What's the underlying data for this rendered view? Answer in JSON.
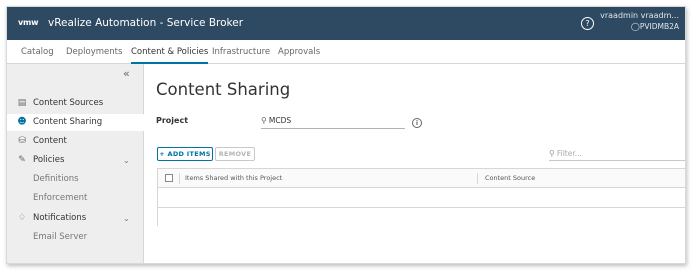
{
  "header": {
    "logo": "vmw",
    "title": "vRealize Automation - Service Broker",
    "help_icon": "help-circle-icon",
    "user_name": "vraadmin vraadm...",
    "org": "PVIDMB2A",
    "colors": {
      "header_bg": "#2e4a62",
      "accent": "#0072a3"
    }
  },
  "topnav": {
    "tabs": [
      {
        "label": "Catalog"
      },
      {
        "label": "Deployments"
      },
      {
        "label": "Content & Policies",
        "active": true
      },
      {
        "label": "Infrastructure"
      },
      {
        "label": "Approvals"
      }
    ]
  },
  "sidebar": {
    "collapse_icon": "double-chevron-left-icon",
    "items": [
      {
        "label": "Content Sources",
        "icon": "content-sources-icon"
      },
      {
        "label": "Content Sharing",
        "icon": "person-icon",
        "active": true
      },
      {
        "label": "Content",
        "icon": "content-icon"
      },
      {
        "label": "Policies",
        "icon": "policies-icon",
        "expandable": true
      },
      {
        "label": "Definitions"
      },
      {
        "label": "Enforcement"
      },
      {
        "label": "Notifications",
        "icon": "bell-icon",
        "expandable": true
      },
      {
        "label": "Email Server"
      }
    ]
  },
  "main": {
    "title": "Content Sharing",
    "project_label": "Project",
    "project_value": "MCDS",
    "info_icon": "info-icon",
    "add_items_label": "+ ADD ITEMS",
    "remove_label": "REMOVE",
    "filter_placeholder": "Filter...",
    "grid": {
      "columns": [
        "Items Shared with this Project",
        "Content Source"
      ]
    }
  }
}
